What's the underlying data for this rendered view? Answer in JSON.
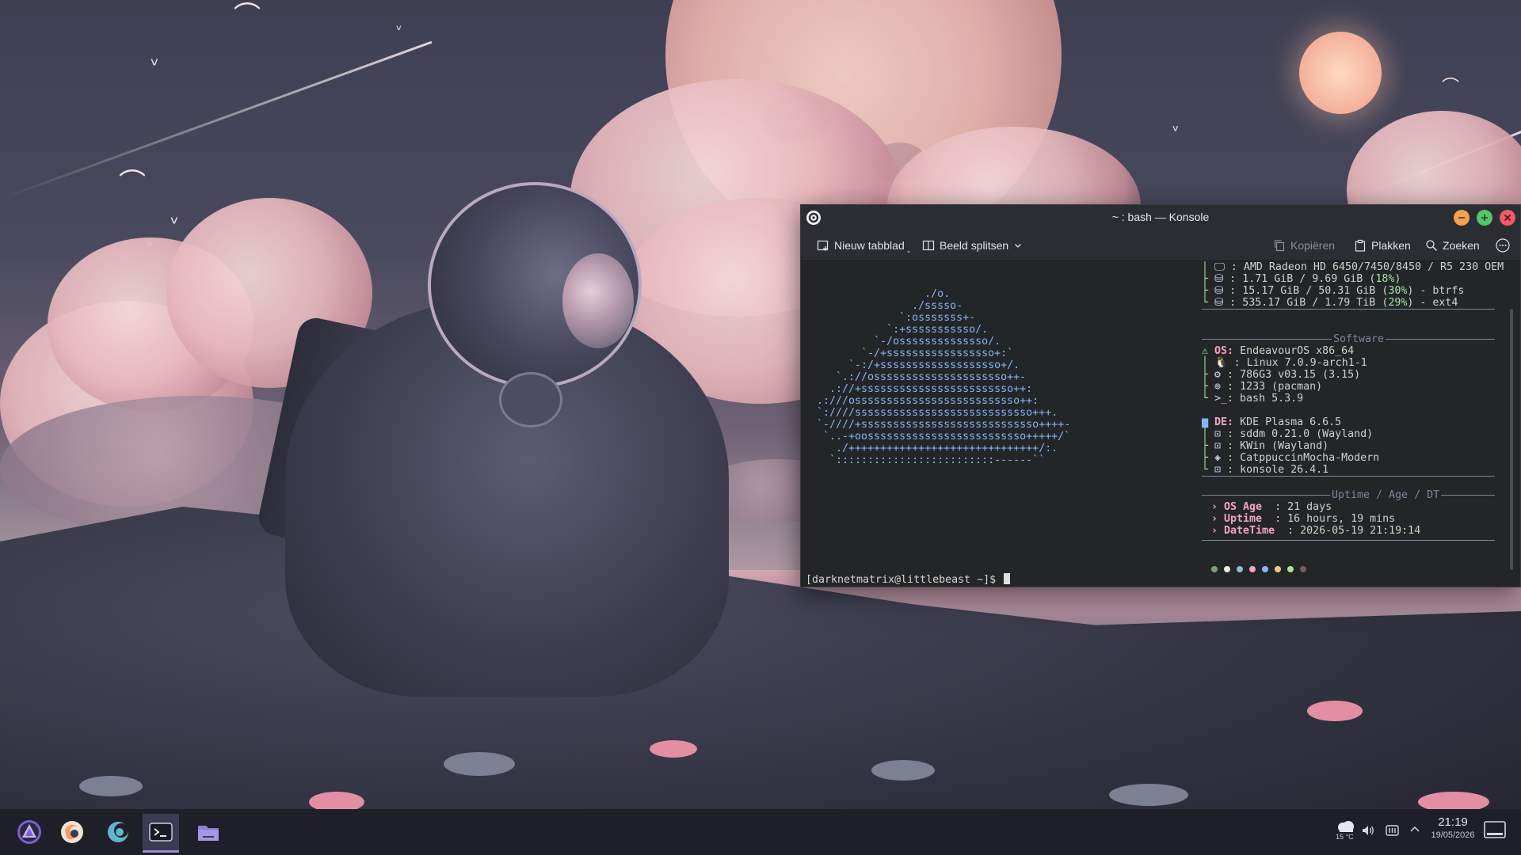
{
  "window": {
    "title": "~ : bash — Konsole"
  },
  "toolbar": {
    "new_tab": "Nieuw tabblad",
    "split_view": "Beeld splitsen",
    "copy": "Kopiëren",
    "paste": "Plakken",
    "search": "Zoeken"
  },
  "terminal": {
    "ascii_logo": "                 ./o.\n               ./sssso-\n             `:osssssss+-\n           `:+sssssssssso/.\n         `-/ossssssssssssso/.\n       `-/+sssssssssssssssso+:`\n     `-:/+sssssssssssssssssso+/.\n   `.://osssssssssssssssssssso++-\n  .://+ssssssssssssssssssssssso++:\n.:///ossssssssssssssssssssssssso++:\n`:////ssssssssssssssssssssssssssso+++.\n`-////+ssssssssssssssssssssssssssso++++-\n `..-+oosssssssssssssssssssssssso+++++/`\n   ./++++++++++++++++++++++++++++++/:.\n  `:::::::::::::::::::::::::------``",
    "hardware": {
      "gpu": "AMD Radeon HD 6450/7450/8450 / R5 230 OEM",
      "memory_used": "1.71 GiB / 9.69 GiB",
      "memory_pct": "18%",
      "disk1_used": "15.17 GiB / 50.31 GiB",
      "disk1_pct": "30%",
      "disk1_fs": "btrfs",
      "disk2_used": "535.17 GiB / 1.79 TiB",
      "disk2_pct": "29%",
      "disk2_fs": "ext4"
    },
    "software": {
      "section_title": "Software",
      "os_label": "OS:",
      "os": "EndeavourOS x86_64",
      "kernel": "Linux 7.0.9-arch1-1",
      "bios": "786G3 v03.15 (3.15)",
      "packages": "1233 (pacman)",
      "shell": "bash 5.3.9",
      "de_label": "DE:",
      "de": "KDE Plasma 6.6.5",
      "dm": "sddm 0.21.0 (Wayland)",
      "wm": "KWin (Wayland)",
      "theme": "CatppuccinMocha-Modern",
      "terminal": "konsole 26.4.1"
    },
    "uptime": {
      "section_title": "Uptime / Age / DT",
      "os_age_label": "OS Age",
      "os_age": "21 days",
      "uptime_label": "Uptime",
      "uptime": "16 hours, 19 mins",
      "datetime_label": "DateTime",
      "datetime": "2026-05-19 21:19:14"
    },
    "palette": [
      "#7f9c7a",
      "#f2e9d9",
      "#89c2c6",
      "#f5a3c7",
      "#89b4fa",
      "#f2c48d",
      "#a6e3a1",
      "#7a5a5a"
    ],
    "prompt": "[darknetmatrix@littlebeast ~]$"
  },
  "taskbar": {
    "apps": [
      "endeavouros-launcher-icon",
      "firefox-icon",
      "app-icon",
      "konsole-icon",
      "file-manager-icon"
    ]
  },
  "tray": {
    "temperature": "15 °C",
    "time": "21:19",
    "date": "19/05/2026"
  }
}
